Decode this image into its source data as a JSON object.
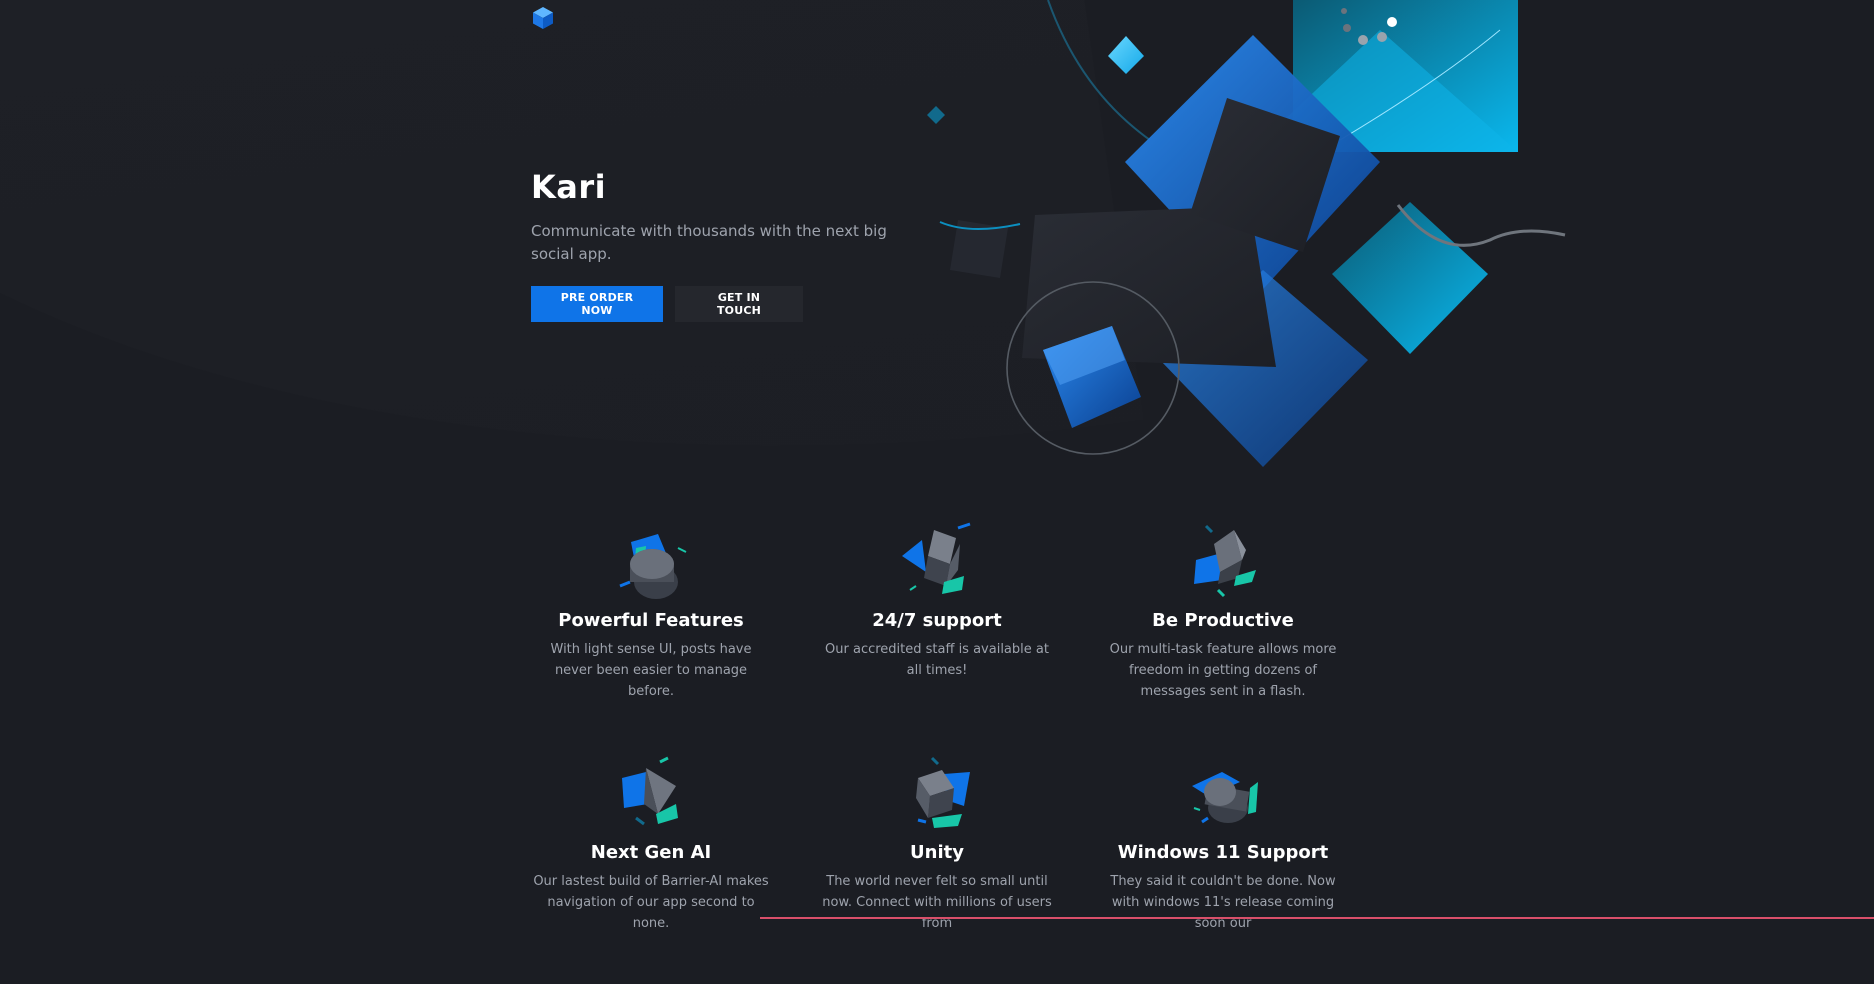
{
  "brand": {
    "logo_icon": "cube-logo-icon",
    "accent": "#0f74e8"
  },
  "hero": {
    "title": "Kari",
    "subtitle": "Communicate with thousands with the next big social app.",
    "primary_button": "PRE ORDER NOW",
    "secondary_button": "GET IN TOUCH"
  },
  "features": [
    {
      "title": "Powerful Features",
      "text": "With light sense UI, posts have never been easier to manage before.",
      "icon": "cylinder-shape-icon"
    },
    {
      "title": "24/7 support",
      "text": "Our accredited staff is available at all times!",
      "icon": "cube-shape-icon"
    },
    {
      "title": "Be Productive",
      "text": "Our multi-task feature allows more freedom in getting dozens of messages sent in a flash.",
      "icon": "cube-tilted-shape-icon"
    },
    {
      "title": "Next Gen AI",
      "text": "Our lastest build of Barrier-AI makes navigation of our app second to none.",
      "icon": "pyramid-shape-icon"
    },
    {
      "title": "Unity",
      "text": "The world never felt so small until now. Connect with millions of users from",
      "icon": "cube-shape-icon"
    },
    {
      "title": "Windows 11 Support",
      "text": "They said it couldn't be done. Now with windows 11's release coming soon our",
      "icon": "cylinder-shape-icon"
    }
  ],
  "colors": {
    "background": "#1b1d23",
    "primary_button": "#0f74e8",
    "secondary_button": "#25272d",
    "muted_text": "#9ea3ad",
    "teal": "#18c6a8"
  }
}
